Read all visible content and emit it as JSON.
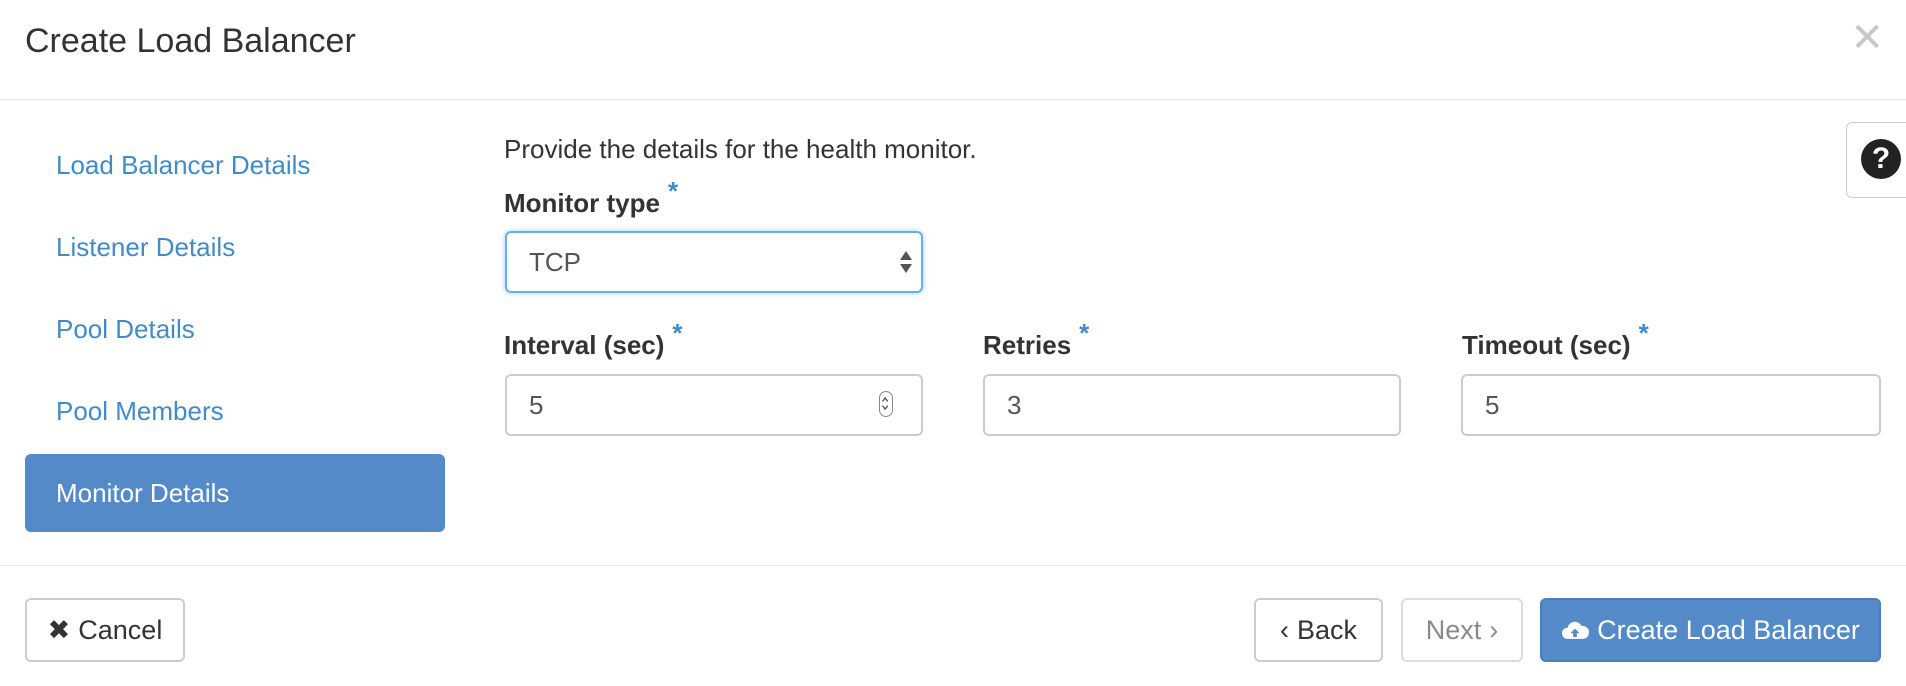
{
  "header": {
    "title": "Create Load Balancer",
    "close_icon": "close-icon"
  },
  "nav": {
    "items": [
      {
        "label": "Load Balancer Details",
        "active": false
      },
      {
        "label": "Listener Details",
        "active": false
      },
      {
        "label": "Pool Details",
        "active": false
      },
      {
        "label": "Pool Members",
        "active": false
      },
      {
        "label": "Monitor Details",
        "active": true
      }
    ]
  },
  "form": {
    "help_text": "Provide the details for the health monitor.",
    "required_marker": "*",
    "monitor_type": {
      "label": "Monitor type",
      "value": "TCP"
    },
    "interval": {
      "label": "Interval (sec)",
      "value": "5"
    },
    "retries": {
      "label": "Retries",
      "value": "3"
    },
    "timeout": {
      "label": "Timeout (sec)",
      "value": "5"
    }
  },
  "footer": {
    "cancel_label": "Cancel",
    "back_label": "Back",
    "next_label": "Next",
    "create_label": "Create Load Balancer"
  },
  "colors": {
    "accent": "#538ac7",
    "link": "#428bca",
    "required": "#428bca"
  }
}
